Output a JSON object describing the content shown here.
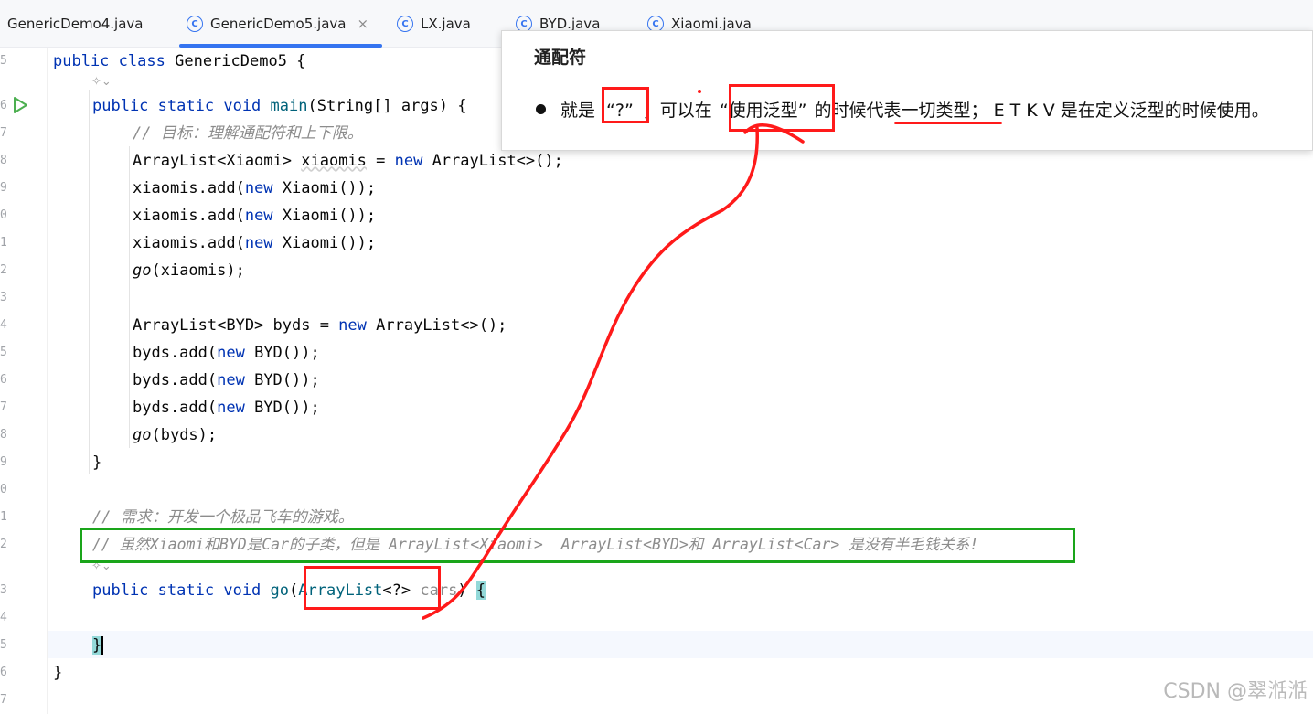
{
  "tabs": [
    {
      "label": "GenericDemo4.java",
      "icon": "",
      "active": false
    },
    {
      "label": "GenericDemo5.java",
      "icon": "java-class-icon",
      "active": true,
      "close": "×"
    },
    {
      "label": "LX.java",
      "icon": "java-class-icon",
      "active": false
    },
    {
      "label": "BYD.java",
      "icon": "java-class-icon",
      "active": false
    },
    {
      "label": "Xiaomi.java",
      "icon": "java-class-icon",
      "active": false
    }
  ],
  "gutter": {
    "line_numbers": [
      "5",
      "",
      "6",
      "7",
      "8",
      "9",
      "0",
      "1",
      "2",
      "3",
      "4",
      "5",
      "6",
      "7",
      "8",
      "9",
      "0",
      "1",
      "2",
      "",
      "3",
      "4",
      "5",
      "6",
      "7"
    ]
  },
  "code": {
    "l1": {
      "kw1": "public",
      "kw2": "class",
      "rest": "GenericDemo5 {"
    },
    "l2": {
      "kw1": "public",
      "kw2": "static",
      "kw3": "void",
      "fn": "main",
      "rest": "(String[] args) {"
    },
    "l3": "// 目标：理解通配符和上下限。",
    "l4": {
      "a": "ArrayList<Xiaomi> ",
      "b": "xiaomis",
      "c": " = ",
      "kw": "new",
      "d": " ArrayList<>();"
    },
    "l5": {
      "a": "xiaomis.add(",
      "kw": "new",
      "b": " Xiaomi());"
    },
    "l6": {
      "a": "xiaomis.add(",
      "kw": "new",
      "b": " Xiaomi());"
    },
    "l7": {
      "a": "xiaomis.add(",
      "kw": "new",
      "b": " Xiaomi());"
    },
    "l8": {
      "fn": "go",
      "rest": "(xiaomis);"
    },
    "l9": {
      "a": "ArrayList<BYD> byds = ",
      "kw": "new",
      "b": " ArrayList<>();"
    },
    "l10": {
      "a": "byds.add(",
      "kw": "new",
      "b": " BYD());"
    },
    "l11": {
      "a": "byds.add(",
      "kw": "new",
      "b": " BYD());"
    },
    "l12": {
      "a": "byds.add(",
      "kw": "new",
      "b": " BYD());"
    },
    "l13": {
      "fn": "go",
      "rest": "(byds);"
    },
    "l14": "}",
    "l15": "// 需求：开发一个极品飞车的游戏。",
    "l16": "// 虽然Xiaomi和BYD是Car的子类，但是 ArrayList<Xiaomi>  ArrayList<BYD>和 ArrayList<Car> 是没有半毛钱关系!",
    "l17": {
      "kw1": "public",
      "kw2": "static",
      "kw3": "void",
      "fn": "go",
      "p1": "(",
      "type": "ArrayList",
      "p2": "<?> ",
      "param": "cars",
      "p3": ") ",
      "brace": "{"
    },
    "l18": "}",
    "l19": "}",
    "inlay_hint": "✧⌄"
  },
  "popup": {
    "title": "通配符",
    "text_parts": [
      "就是",
      "“?”",
      "，可以在",
      "“使用泛型”",
      "的时候",
      "代表一切类型",
      "；  E T K V 是在定义泛型的时候使用。"
    ]
  },
  "watermark": "CSDN @翠湉湉"
}
